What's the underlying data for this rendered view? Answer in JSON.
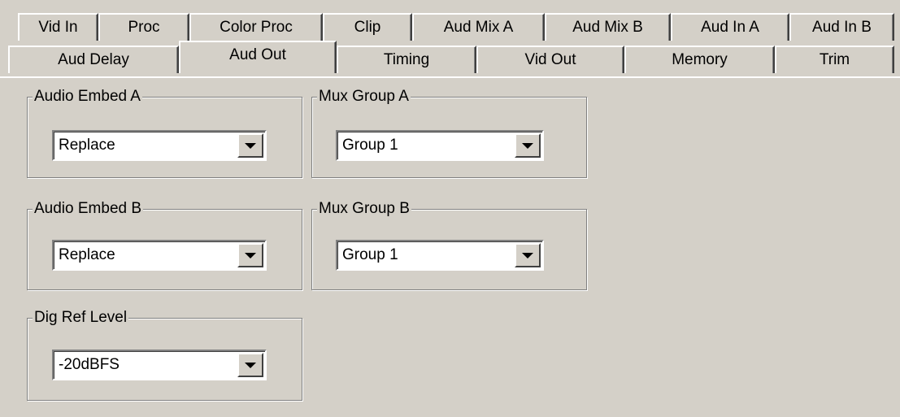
{
  "tabs_row1": [
    "Vid In",
    "Proc",
    "Color Proc",
    "Clip",
    "Aud Mix A",
    "Aud Mix B",
    "Aud In A",
    "Aud In B"
  ],
  "tabs_row2": [
    "Aud Delay",
    "Aud Out",
    "Timing",
    "Vid Out",
    "Memory",
    "Trim"
  ],
  "active_tab": "Aud Out",
  "groups": {
    "audio_embed_a": {
      "title": "Audio Embed A",
      "value": "Replace"
    },
    "mux_group_a": {
      "title": "Mux Group A",
      "value": "Group 1"
    },
    "audio_embed_b": {
      "title": "Audio Embed B",
      "value": "Replace"
    },
    "mux_group_b": {
      "title": "Mux Group B",
      "value": "Group 1"
    },
    "dig_ref_level": {
      "title": "Dig Ref Level",
      "value": "-20dBFS"
    }
  },
  "icons": {
    "dropdown": "chevron-down-icon"
  }
}
